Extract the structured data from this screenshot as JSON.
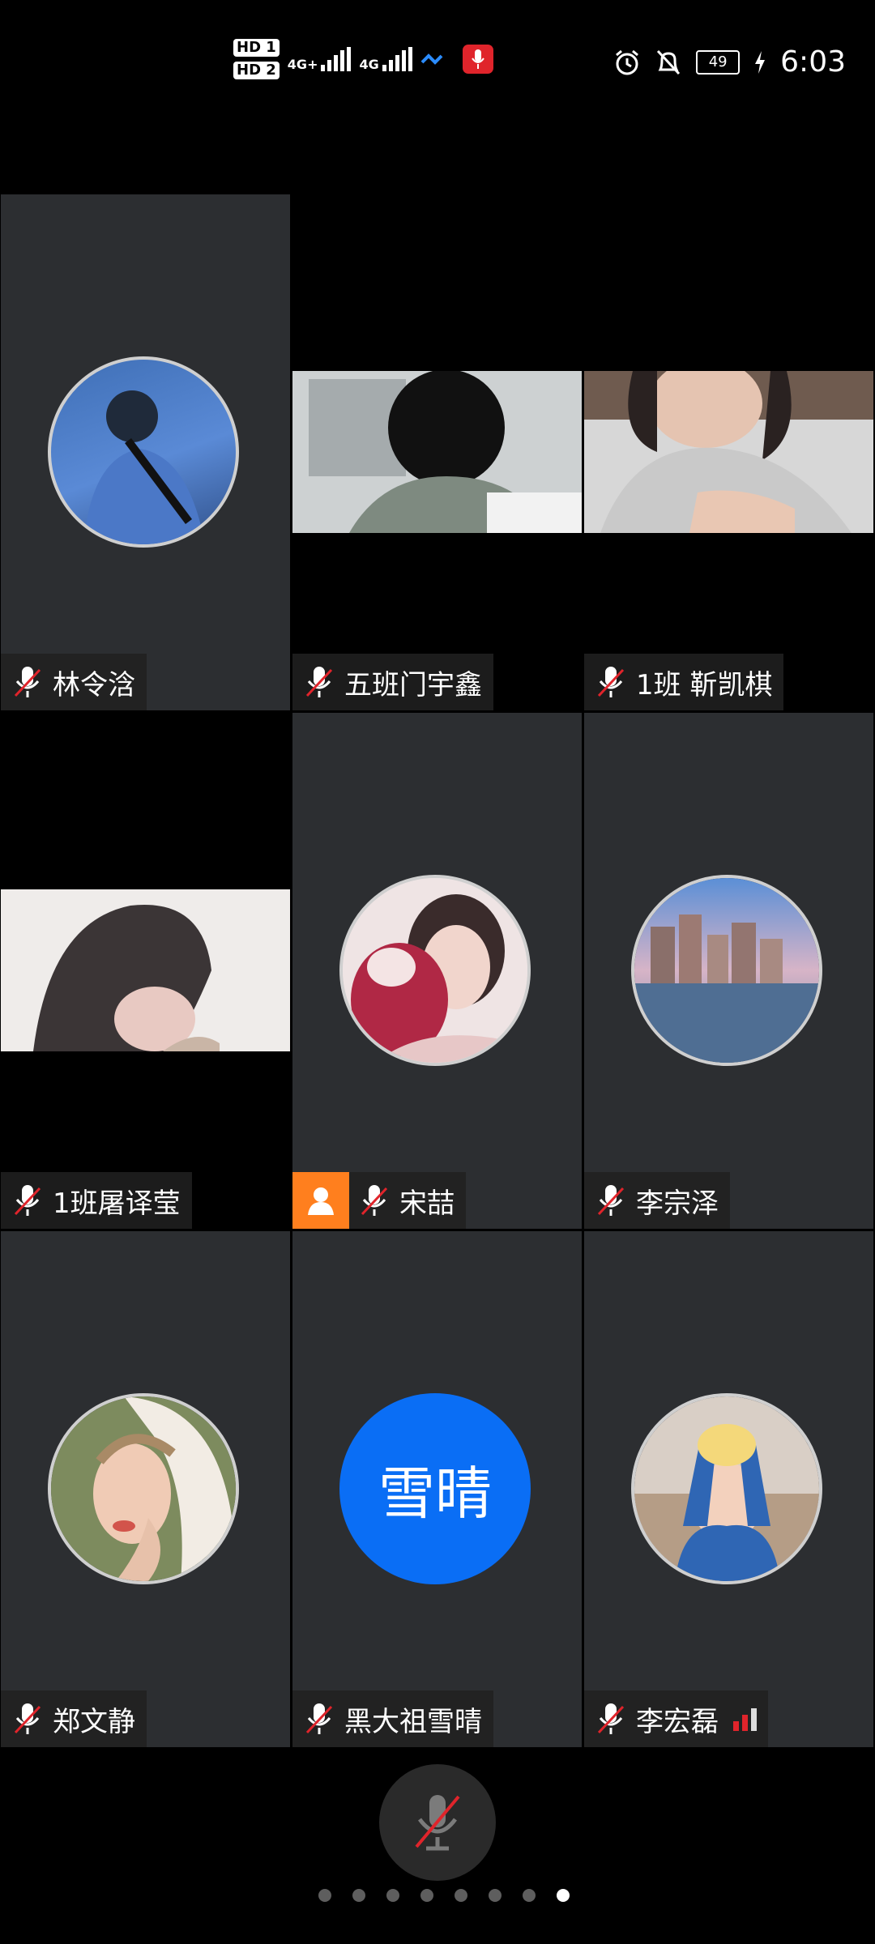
{
  "status_bar": {
    "hd1": "HD 1",
    "hd2": "HD 2",
    "net1": "4G+",
    "net2": "4G",
    "battery": "49",
    "time": "6:03",
    "icons": [
      "signal-icon",
      "wifi-icon",
      "recording-mic-icon",
      "alarm-icon",
      "do-not-disturb-icon",
      "battery-icon",
      "charging-icon"
    ]
  },
  "participants": [
    {
      "name": "林令浛",
      "type": "avatar",
      "muted": true
    },
    {
      "name": "五班门宇鑫",
      "type": "video",
      "muted": true
    },
    {
      "name": "1班 靳凯棋",
      "type": "video",
      "muted": true
    },
    {
      "name": "1班屠译莹",
      "type": "video",
      "muted": true
    },
    {
      "name": "宋喆",
      "type": "avatar",
      "muted": true,
      "host": true
    },
    {
      "name": "李宗泽",
      "type": "avatar",
      "muted": true
    },
    {
      "name": "郑文静",
      "type": "avatar",
      "muted": true
    },
    {
      "name": "黑大祖雪晴",
      "type": "initials",
      "initials": "雪晴",
      "muted": true
    },
    {
      "name": "李宏磊",
      "type": "avatar",
      "muted": true,
      "signal": "weak"
    }
  ],
  "controls": {
    "mute_icon": "mic-muted-icon",
    "page_count": 8,
    "active_page": 8
  },
  "colors": {
    "tile_bg": "#2c2e31",
    "initials_avatar": "#0a6ef5",
    "host_badge": "#ff7f1e",
    "muted_slash": "#e0242b"
  }
}
